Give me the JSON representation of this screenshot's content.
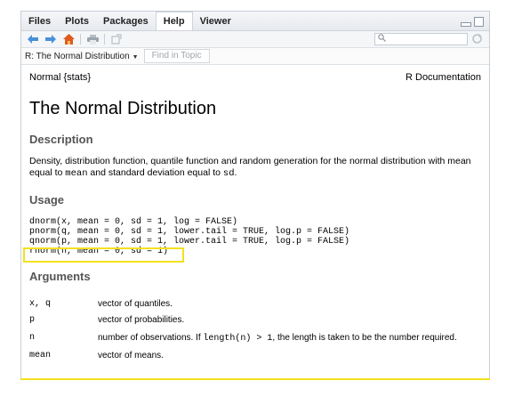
{
  "tabs": [
    {
      "label": "Files",
      "active": false
    },
    {
      "label": "Plots",
      "active": false
    },
    {
      "label": "Packages",
      "active": false
    },
    {
      "label": "Help",
      "active": true
    },
    {
      "label": "Viewer",
      "active": false
    }
  ],
  "toolbar": {
    "icons": [
      "back-arrow-icon",
      "forward-arrow-icon",
      "home-icon",
      "print-icon",
      "open-in-window-icon"
    ],
    "search_placeholder": "",
    "colors": {
      "accent": "#3b8ad9",
      "home": "#e05a1e"
    }
  },
  "topicbar": {
    "topic": "R: The Normal Distribution",
    "find_placeholder": "Find in Topic"
  },
  "doc": {
    "package": "Normal {stats}",
    "doc_label": "R Documentation",
    "title": "The Normal Distribution",
    "description_heading": "Description",
    "description_1": "Density, distribution function, quantile function and random generation for the normal distribution with mean equal to ",
    "description_code_1": "mean",
    "description_2": " and standard deviation equal to ",
    "description_code_2": "sd",
    "description_3": ".",
    "usage_heading": "Usage",
    "usage_lines": [
      "dnorm(x, mean = 0, sd = 1, log = FALSE)",
      "pnorm(q, mean = 0, sd = 1, lower.tail = TRUE, log.p = FALSE)",
      "qnorm(p, mean = 0, sd = 1, lower.tail = TRUE, log.p = FALSE)",
      "rnorm(n, mean = 0, sd = 1)"
    ],
    "arguments_heading": "Arguments",
    "arguments": [
      {
        "name": "x, q",
        "text": "vector of quantiles."
      },
      {
        "name": "p",
        "text": "vector of probabilities."
      },
      {
        "name": "n",
        "text_1": "number of observations. If ",
        "code": "length(n) > 1",
        "text_2": ", the length is taken to be the number required."
      },
      {
        "name": "mean",
        "text": "vector of means."
      }
    ]
  },
  "highlight_color": "#f3e11d"
}
